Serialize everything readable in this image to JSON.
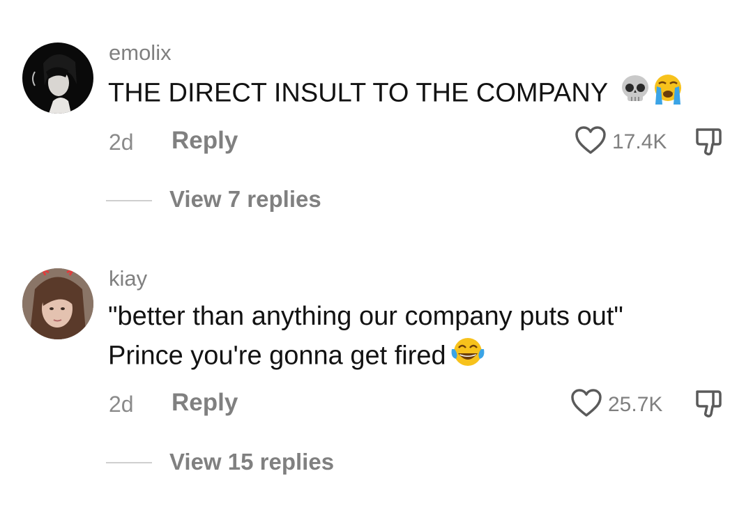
{
  "comments": [
    {
      "username": "emolix",
      "text": "THE DIRECT INSULT TO THE COMPANY",
      "emojis": [
        "skull-emoji",
        "loudly-crying-emoji"
      ],
      "date": "2d",
      "reply_label": "Reply",
      "like_count": "17.4K",
      "view_replies": "View 7 replies"
    },
    {
      "username": "kiay",
      "text_line1": "\"better than anything our company puts out\"",
      "text_line2": "Prince you're gonna get fired",
      "emojis": [
        "tears-of-joy-emoji"
      ],
      "date": "2d",
      "reply_label": "Reply",
      "like_count": "25.7K",
      "view_replies": "View 15 replies"
    }
  ],
  "icons": {
    "like": "heart-outline-icon",
    "dislike": "thumbs-down-icon"
  },
  "colors": {
    "background": "#ffffff",
    "text": "#121212",
    "secondary": "#808080"
  }
}
